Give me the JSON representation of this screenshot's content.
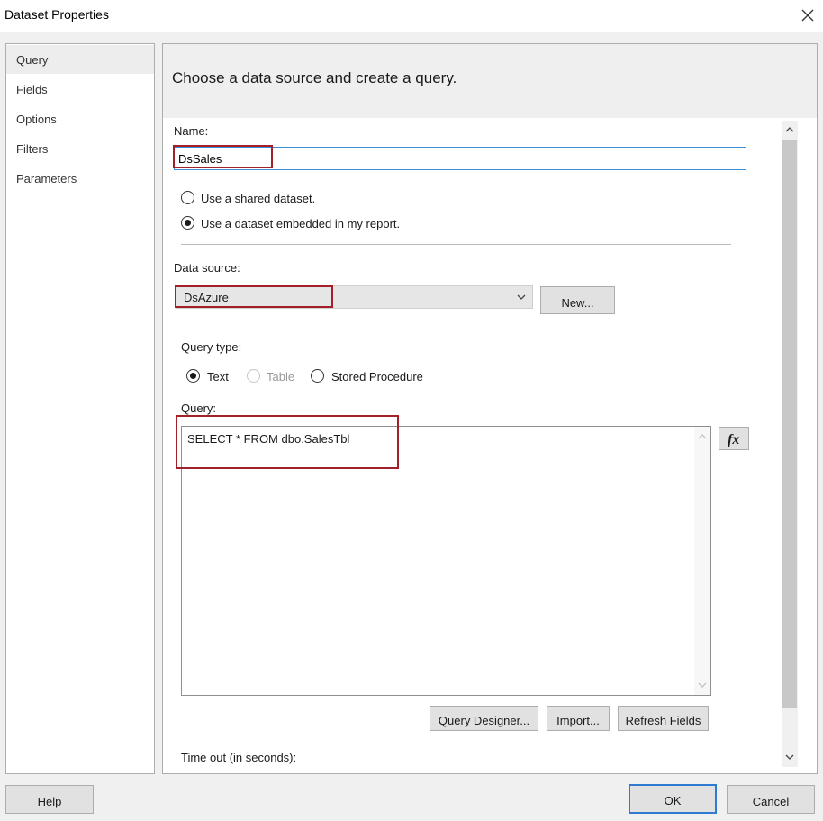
{
  "window": {
    "title": "Dataset Properties"
  },
  "nav": {
    "items": [
      {
        "label": "Query",
        "selected": true
      },
      {
        "label": "Fields"
      },
      {
        "label": "Options"
      },
      {
        "label": "Filters"
      },
      {
        "label": "Parameters"
      }
    ]
  },
  "header": {
    "text": "Choose a data source and create a query."
  },
  "form": {
    "name_label": "Name:",
    "name_value": "DsSales",
    "radio_shared": "Use a shared dataset.",
    "radio_embedded": "Use a dataset embedded in my report.",
    "datasource_label": "Data source:",
    "datasource_value": "DsAzure",
    "new_button": "New...",
    "query_type_label": "Query type:",
    "qt_text": "Text",
    "qt_table": "Table",
    "qt_stored": "Stored Procedure",
    "query_label": "Query:",
    "query_text": "SELECT * FROM dbo.SalesTbl",
    "query_designer_button": "Query Designer...",
    "import_button": "Import...",
    "refresh_button": "Refresh Fields",
    "timeout_label": "Time out (in seconds):"
  },
  "footer": {
    "help": "Help",
    "ok": "OK",
    "cancel": "Cancel"
  },
  "colors": {
    "highlight": "#a3202a",
    "focus": "#2d7cd1"
  }
}
